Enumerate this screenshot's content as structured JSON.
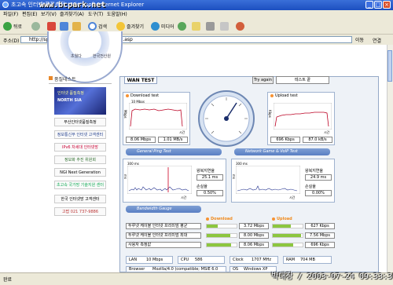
{
  "window": {
    "title": "초고속 인터넷 품질측정 - Microsoft Internet Explorer",
    "watermark": "www.bcpark.net"
  },
  "menu": [
    "파일(F)",
    "편집(E)",
    "보기(V)",
    "즐겨찾기(A)",
    "도구(T)",
    "도움말(H)"
  ],
  "toolbar": {
    "back": "뒤로",
    "search": "검색",
    "favorites": "즐겨찾기",
    "media": "미디어"
  },
  "address": {
    "label": "주소(D)",
    "url": "http://speed.nca.or.kr/speedtest/default.asp",
    "go": "이동",
    "links": "연결"
  },
  "logo": {
    "left": "초월다",
    "right": "한국전산원"
  },
  "sidebar": {
    "header": "품질테스트",
    "banner_line1": "인터넷 품질측정",
    "banner_line2": "NORTH SIA",
    "links": [
      "부산인터넷품질측정",
      "정보통신부 인터넷 고객센터",
      "IPv6 차세대 인터넷망",
      "정보화 추진 위원회",
      "NGI Next Generation",
      "초고속 국가망 기술지원 센터",
      "한국 인터넷망 고객센터",
      "고팝 021 737-9886"
    ]
  },
  "panel": {
    "tab": "WAN TEST",
    "try_again": "Try again",
    "test_select": "테스트 끝"
  },
  "download": {
    "title": "Download test",
    "unit": "Mbps",
    "ymax": "10 Mbps",
    "xlabel": "시간",
    "mbps": "8.06 Mbps",
    "mbs": "1.01 MB/s"
  },
  "upload": {
    "title": "Upload test",
    "unit": "Kbps",
    "xlabel": "시간",
    "kbps": "696 Kbps",
    "kbs": "87.0 kB/s"
  },
  "ping": {
    "section": "General Ping Test",
    "ymax": "300 ms",
    "ylabel": "ms",
    "xlabel": "시간",
    "rtt_label": "왕복지연율",
    "rtt": "25.1 ms",
    "loss_label": "손실율",
    "loss": "0.50%"
  },
  "voip": {
    "section": "Network Game & VoIP Test",
    "ymax": "300 ms",
    "ylabel": "ms",
    "xlabel": "시간",
    "rtt_label": "왕복지연율",
    "rtt": "24.9 ms",
    "loss_label": "손실율",
    "loss": "0.00%"
  },
  "gauge_section": {
    "title": "Bandwidth Gauge",
    "download_header": "Download",
    "upload_header": "Upload",
    "rows": [
      {
        "label": "두루넷 케이블 인터넷 프리미엄 평균",
        "down": "3.72 Mbps",
        "down_frac": 0.37,
        "up": "627 Kbps",
        "up_frac": 0.61
      },
      {
        "label": "두루넷 케이블 인터넷 프리미엄 최대",
        "down": "8.00 Mbps",
        "down_frac": 0.8,
        "up": "7.56 Mbps",
        "up_frac": 0.95
      },
      {
        "label": "사용자 측정값",
        "down": "8.06 Mbps",
        "down_frac": 0.81,
        "up": "696 Kbps",
        "up_frac": 0.68
      }
    ]
  },
  "system": {
    "lan_label": "LAN",
    "lan": "10 Mbps",
    "cpu_label": "CPU",
    "cpu": "586",
    "clock_label": "Clock",
    "clock": "1707 MHz",
    "ram_label": "RAM",
    "ram": "704 MB",
    "browser_label": "Browser",
    "browser": "Mozilla/4.0 (compatible; MSIE 6.0",
    "os_label": "OS",
    "os": "Windows XP"
  },
  "status": {
    "text": "완료"
  },
  "caption": "박대장 / 2003-07-24 09:33:30",
  "colors": {
    "accent": "#f79233",
    "bar": "#8cc63f",
    "section": "#5a7fc3"
  }
}
